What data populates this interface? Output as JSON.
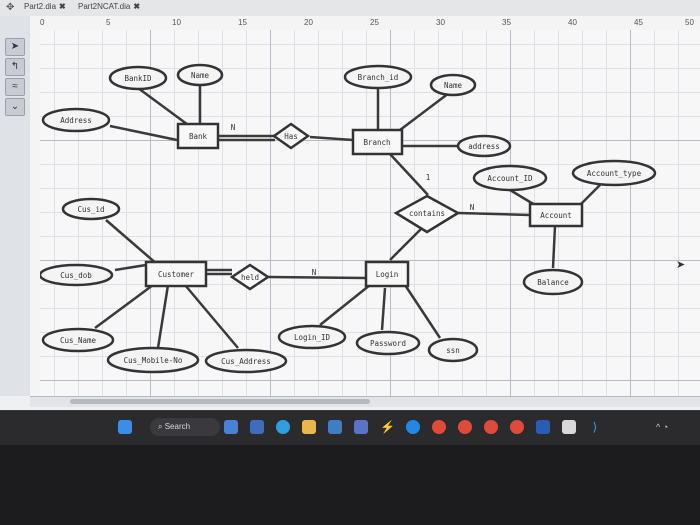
{
  "tabs": [
    {
      "label": "Part2.dia"
    },
    {
      "label": "Part2NCAT.dia"
    }
  ],
  "ruler": {
    "marks": [
      "0",
      "5",
      "10",
      "15",
      "20",
      "25",
      "30",
      "35",
      "40",
      "45",
      "50"
    ]
  },
  "taskbar": {
    "search_label": "Search"
  },
  "diagram": {
    "entities": {
      "bank": "Bank",
      "branch": "Branch",
      "account": "Account",
      "customer": "Customer",
      "login": "Login"
    },
    "relationships": {
      "has": "Has",
      "contains": "contains",
      "held": "held"
    },
    "attributes": {
      "bank_id": "BankID",
      "bank_name": "Name",
      "bank_address": "Address",
      "branch_id": "Branch_id",
      "branch_name": "Name",
      "branch_address": "address",
      "account_id": "Account_ID",
      "account_type": "Account_type",
      "balance": "Balance",
      "cus_id": "Cus_id",
      "cus_dob": "Cus_dob",
      "cus_name": "Cus_Name",
      "cus_mobile": "Cus_Mobile-No",
      "cus_address": "Cus_Address",
      "login_id": "Login_ID",
      "password": "Password",
      "ssn": "ssn"
    },
    "cardinalities": {
      "bank_has": "N",
      "branch_contains": "1",
      "contains_account": "N",
      "held_login": "N"
    }
  }
}
